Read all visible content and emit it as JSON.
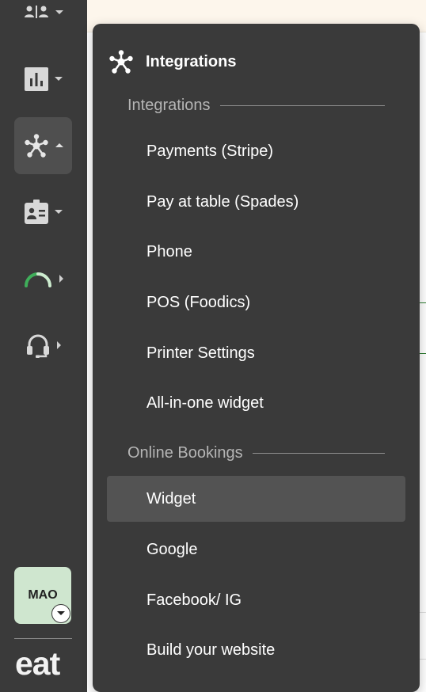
{
  "sidebar": {
    "nav": [
      {
        "icon": "team-icon",
        "expanded": false
      },
      {
        "icon": "bar-chart-icon",
        "expanded": false
      },
      {
        "icon": "integrations-icon",
        "expanded": true
      },
      {
        "icon": "id-badge-icon",
        "expanded": false
      },
      {
        "icon": "gauge-icon",
        "expanded": false
      },
      {
        "icon": "headset-icon",
        "expanded": false
      }
    ],
    "avatar_text": "MAO",
    "logo_text": "eat"
  },
  "menu": {
    "title": "Integrations",
    "sections": [
      {
        "label": "Integrations",
        "items": [
          "Payments (Stripe)",
          "Pay at table (Spades)",
          "Phone",
          "POS (Foodics)",
          "Printer Settings",
          "All-in-one widget"
        ]
      },
      {
        "label": "Online Bookings",
        "items": [
          "Widget",
          "Google",
          "Facebook/ IG",
          "Build your website"
        ]
      }
    ],
    "selected_item": "Widget"
  },
  "colors": {
    "sidebar_bg": "#3a3a3a",
    "active_bg": "#4f4f4f",
    "selected_bg": "#535353",
    "avatar_bg": "#cfe6cf",
    "accent_green": "#2e7d32"
  }
}
